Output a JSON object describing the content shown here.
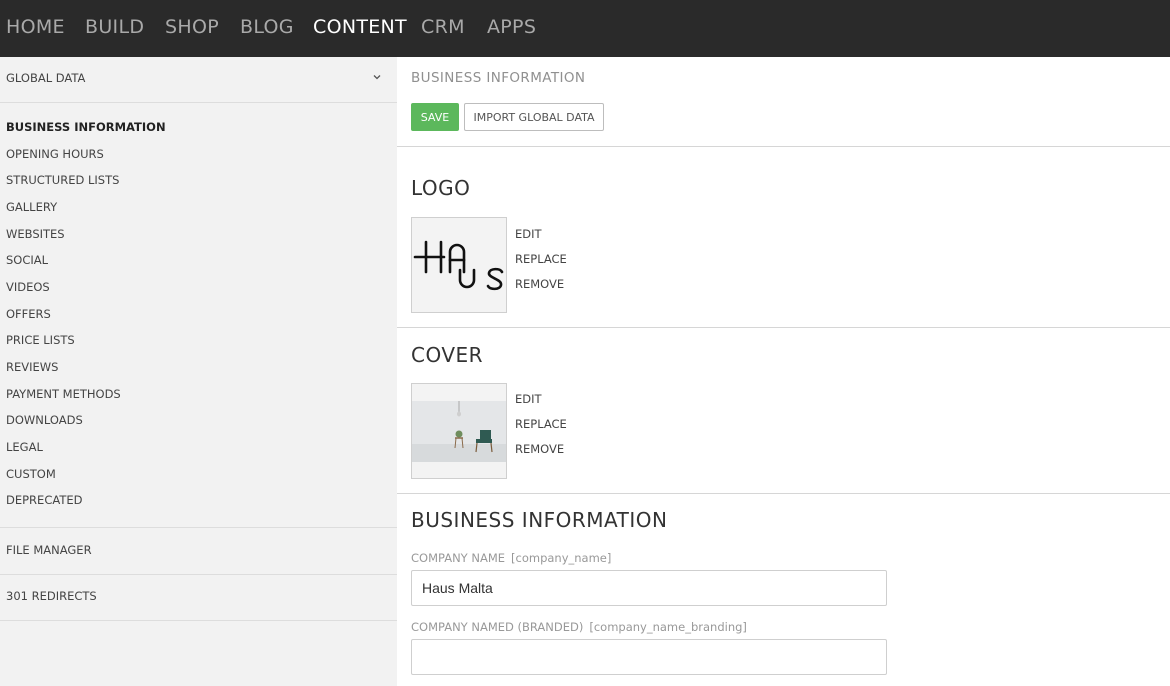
{
  "nav": {
    "items": [
      "HOME",
      "BUILD",
      "SHOP",
      "BLOG",
      "CONTENT",
      "CRM",
      "APPS"
    ],
    "active": "CONTENT"
  },
  "sidebar": {
    "global_label": "GLOBAL DATA",
    "items": [
      "BUSINESS INFORMATION",
      "OPENING HOURS",
      "STRUCTURED LISTS",
      "GALLERY",
      "WEBSITES",
      "SOCIAL",
      "VIDEOS",
      "OFFERS",
      "PRICE LISTS",
      "REVIEWS",
      "PAYMENT METHODS",
      "DOWNLOADS",
      "LEGAL",
      "CUSTOM",
      "DEPRECATED"
    ],
    "active_item": "BUSINESS INFORMATION",
    "file_manager": "FILE MANAGER",
    "redirects": "301 REDIRECTS"
  },
  "main": {
    "page_title": "BUSINESS INFORMATION",
    "save_label": "SAVE",
    "import_label": "IMPORT GLOBAL DATA",
    "logo": {
      "heading": "LOGO",
      "logo_text": "HAUS",
      "actions": {
        "edit": "EDIT",
        "replace": "REPLACE",
        "remove": "REMOVE"
      }
    },
    "cover": {
      "heading": "COVER",
      "actions": {
        "edit": "EDIT",
        "replace": "REPLACE",
        "remove": "REMOVE"
      }
    },
    "business": {
      "heading": "BUSINESS INFORMATION",
      "company_name_label": "COMPANY NAME",
      "company_name_code": "[company_name]",
      "company_name_value": "Haus Malta",
      "company_branded_label": "COMPANY NAMED (BRANDED)",
      "company_branded_code": "[company_name_branding]",
      "company_branded_value": ""
    }
  },
  "colors": {
    "nav_bg": "#2a2a2a",
    "sidebar_bg": "#f2f2f2",
    "save_green": "#5cb85c"
  }
}
